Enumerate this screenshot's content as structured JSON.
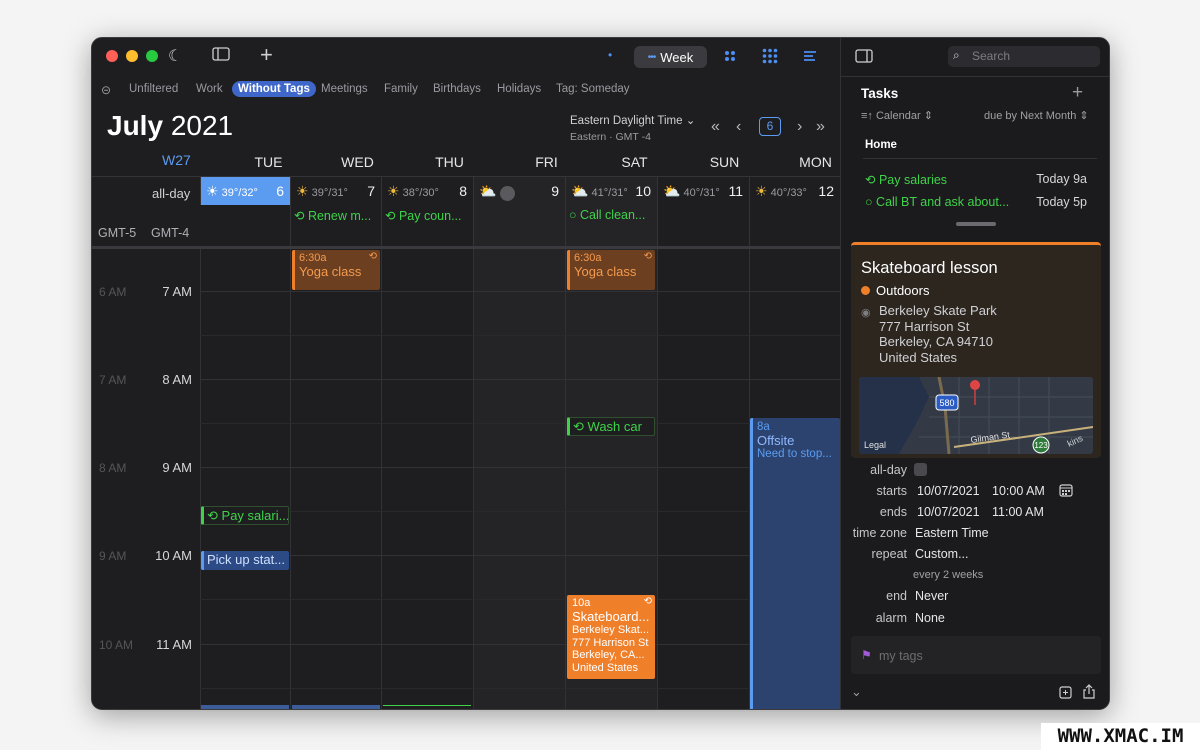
{
  "window": {
    "view_label": "Week",
    "search_placeholder": "Search"
  },
  "filters": [
    "Unfiltered",
    "Work",
    "Without Tags",
    "Meetings",
    "Family",
    "Birthdays",
    "Holidays",
    "Tag: Someday"
  ],
  "active_filter": "Without Tags",
  "header": {
    "month": "July",
    "year": "2021",
    "timezone": "Eastern Daylight Time",
    "timezone_sub": "Eastern · GMT -4",
    "today_number": "6",
    "week_label": "W27"
  },
  "days": [
    {
      "name": "TUE",
      "num": "6",
      "weather": "39°/32°",
      "task": "",
      "today": true
    },
    {
      "name": "WED",
      "num": "7",
      "weather": "39°/31°",
      "task": "Renew m..."
    },
    {
      "name": "THU",
      "num": "8",
      "weather": "38°/30°",
      "task": "Pay coun..."
    },
    {
      "name": "FRI",
      "num": "9",
      "weather": "",
      "task": ""
    },
    {
      "name": "SAT",
      "num": "10",
      "weather": "41°/31°",
      "task": "Call clean..."
    },
    {
      "name": "SUN",
      "num": "11",
      "weather": "40°/31°",
      "task": ""
    },
    {
      "name": "MON",
      "num": "12",
      "weather": "40°/33°",
      "task": ""
    }
  ],
  "allday_label": "all-day",
  "gmt_labels": [
    "GMT-5",
    "GMT-4"
  ],
  "hours": [
    "7 AM",
    "8 AM",
    "9 AM",
    "10 AM",
    "11 AM"
  ],
  "hours_alt": [
    "6 AM",
    "7 AM",
    "8 AM",
    "9 AM",
    "10 AM"
  ],
  "events": {
    "yoga_time": "6:30a",
    "yoga_name": "Yoga class",
    "wash_car": "Wash car",
    "pay_salaries": "Pay salari...",
    "pick_up": "Pick up stat...",
    "skate_time": "10a",
    "skate_name": "Skateboard...",
    "skate_loc": [
      "Berkeley Skat...",
      "777 Harrison St",
      "Berkeley, CA...",
      "United States"
    ],
    "offsite_time": "8a",
    "offsite_name": "Offsite",
    "offsite_desc": "Need to stop..."
  },
  "tasks_panel": {
    "title": "Tasks",
    "calendar_opt": "Calendar",
    "sort_opt": "due by Next Month",
    "group": "Home",
    "items": [
      {
        "name": "Pay salaries",
        "time": "Today 9a"
      },
      {
        "name": "Call BT and ask about...",
        "time": "Today 5p"
      }
    ]
  },
  "detail": {
    "title": "Skateboard lesson",
    "calendar": "Outdoors",
    "address": [
      "Berkeley Skate Park",
      "777 Harrison St",
      "Berkeley, CA  94710",
      "United States"
    ],
    "map_labels": {
      "legal": "Legal",
      "street": "Gilman St",
      "highway1": "580",
      "highway2": "123",
      "street2": "kins"
    },
    "allday_label": "all-day",
    "starts_label": "starts",
    "starts_date": "10/07/2021",
    "starts_time": "10:00 AM",
    "ends_label": "ends",
    "ends_date": "10/07/2021",
    "ends_time": "11:00 AM",
    "tz_label": "time zone",
    "tz_value": "Eastern Time",
    "repeat_label": "repeat",
    "repeat_value": "Custom...",
    "repeat_sub": "every 2 weeks",
    "end_label": "end",
    "end_value": "Never",
    "alarm_label": "alarm",
    "alarm_value": "None",
    "tags_placeholder": "my tags"
  },
  "watermark": "WWW.XMAC.IM",
  "colors": {
    "accent": "#5b9cf0",
    "task_green": "#3fd24a",
    "event_orange": "#f07f2a"
  }
}
